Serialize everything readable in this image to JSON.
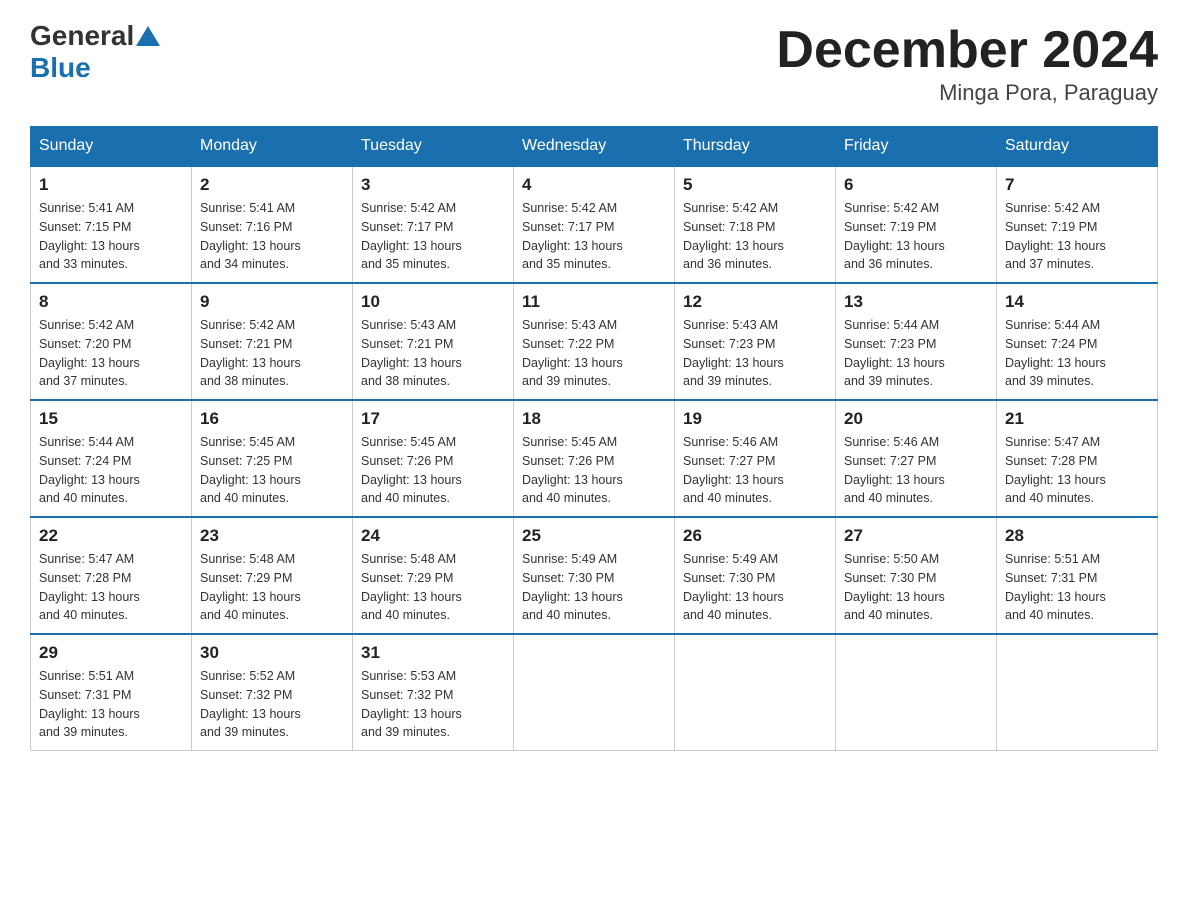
{
  "logo": {
    "general": "General",
    "blue": "Blue"
  },
  "title": "December 2024",
  "subtitle": "Minga Pora, Paraguay",
  "days_header": [
    "Sunday",
    "Monday",
    "Tuesday",
    "Wednesday",
    "Thursday",
    "Friday",
    "Saturday"
  ],
  "weeks": [
    [
      {
        "day": "1",
        "sunrise": "5:41 AM",
        "sunset": "7:15 PM",
        "daylight": "13 hours and 33 minutes."
      },
      {
        "day": "2",
        "sunrise": "5:41 AM",
        "sunset": "7:16 PM",
        "daylight": "13 hours and 34 minutes."
      },
      {
        "day": "3",
        "sunrise": "5:42 AM",
        "sunset": "7:17 PM",
        "daylight": "13 hours and 35 minutes."
      },
      {
        "day": "4",
        "sunrise": "5:42 AM",
        "sunset": "7:17 PM",
        "daylight": "13 hours and 35 minutes."
      },
      {
        "day": "5",
        "sunrise": "5:42 AM",
        "sunset": "7:18 PM",
        "daylight": "13 hours and 36 minutes."
      },
      {
        "day": "6",
        "sunrise": "5:42 AM",
        "sunset": "7:19 PM",
        "daylight": "13 hours and 36 minutes."
      },
      {
        "day": "7",
        "sunrise": "5:42 AM",
        "sunset": "7:19 PM",
        "daylight": "13 hours and 37 minutes."
      }
    ],
    [
      {
        "day": "8",
        "sunrise": "5:42 AM",
        "sunset": "7:20 PM",
        "daylight": "13 hours and 37 minutes."
      },
      {
        "day": "9",
        "sunrise": "5:42 AM",
        "sunset": "7:21 PM",
        "daylight": "13 hours and 38 minutes."
      },
      {
        "day": "10",
        "sunrise": "5:43 AM",
        "sunset": "7:21 PM",
        "daylight": "13 hours and 38 minutes."
      },
      {
        "day": "11",
        "sunrise": "5:43 AM",
        "sunset": "7:22 PM",
        "daylight": "13 hours and 39 minutes."
      },
      {
        "day": "12",
        "sunrise": "5:43 AM",
        "sunset": "7:23 PM",
        "daylight": "13 hours and 39 minutes."
      },
      {
        "day": "13",
        "sunrise": "5:44 AM",
        "sunset": "7:23 PM",
        "daylight": "13 hours and 39 minutes."
      },
      {
        "day": "14",
        "sunrise": "5:44 AM",
        "sunset": "7:24 PM",
        "daylight": "13 hours and 39 minutes."
      }
    ],
    [
      {
        "day": "15",
        "sunrise": "5:44 AM",
        "sunset": "7:24 PM",
        "daylight": "13 hours and 40 minutes."
      },
      {
        "day": "16",
        "sunrise": "5:45 AM",
        "sunset": "7:25 PM",
        "daylight": "13 hours and 40 minutes."
      },
      {
        "day": "17",
        "sunrise": "5:45 AM",
        "sunset": "7:26 PM",
        "daylight": "13 hours and 40 minutes."
      },
      {
        "day": "18",
        "sunrise": "5:45 AM",
        "sunset": "7:26 PM",
        "daylight": "13 hours and 40 minutes."
      },
      {
        "day": "19",
        "sunrise": "5:46 AM",
        "sunset": "7:27 PM",
        "daylight": "13 hours and 40 minutes."
      },
      {
        "day": "20",
        "sunrise": "5:46 AM",
        "sunset": "7:27 PM",
        "daylight": "13 hours and 40 minutes."
      },
      {
        "day": "21",
        "sunrise": "5:47 AM",
        "sunset": "7:28 PM",
        "daylight": "13 hours and 40 minutes."
      }
    ],
    [
      {
        "day": "22",
        "sunrise": "5:47 AM",
        "sunset": "7:28 PM",
        "daylight": "13 hours and 40 minutes."
      },
      {
        "day": "23",
        "sunrise": "5:48 AM",
        "sunset": "7:29 PM",
        "daylight": "13 hours and 40 minutes."
      },
      {
        "day": "24",
        "sunrise": "5:48 AM",
        "sunset": "7:29 PM",
        "daylight": "13 hours and 40 minutes."
      },
      {
        "day": "25",
        "sunrise": "5:49 AM",
        "sunset": "7:30 PM",
        "daylight": "13 hours and 40 minutes."
      },
      {
        "day": "26",
        "sunrise": "5:49 AM",
        "sunset": "7:30 PM",
        "daylight": "13 hours and 40 minutes."
      },
      {
        "day": "27",
        "sunrise": "5:50 AM",
        "sunset": "7:30 PM",
        "daylight": "13 hours and 40 minutes."
      },
      {
        "day": "28",
        "sunrise": "5:51 AM",
        "sunset": "7:31 PM",
        "daylight": "13 hours and 40 minutes."
      }
    ],
    [
      {
        "day": "29",
        "sunrise": "5:51 AM",
        "sunset": "7:31 PM",
        "daylight": "13 hours and 39 minutes."
      },
      {
        "day": "30",
        "sunrise": "5:52 AM",
        "sunset": "7:32 PM",
        "daylight": "13 hours and 39 minutes."
      },
      {
        "day": "31",
        "sunrise": "5:53 AM",
        "sunset": "7:32 PM",
        "daylight": "13 hours and 39 minutes."
      },
      null,
      null,
      null,
      null
    ]
  ],
  "labels": {
    "sunrise": "Sunrise:",
    "sunset": "Sunset:",
    "daylight": "Daylight:"
  }
}
